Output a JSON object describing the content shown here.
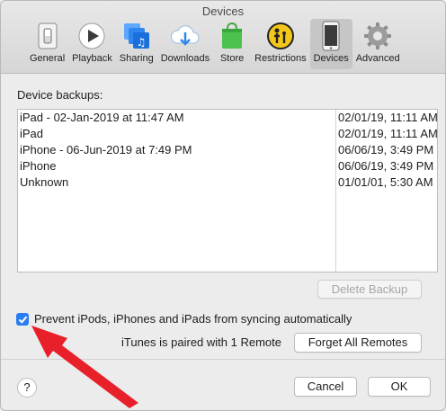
{
  "window": {
    "title": "Devices"
  },
  "toolbar": {
    "items": [
      {
        "label": "General",
        "icon": "general-switch-icon"
      },
      {
        "label": "Playback",
        "icon": "play-icon"
      },
      {
        "label": "Sharing",
        "icon": "sharing-music-icon"
      },
      {
        "label": "Downloads",
        "icon": "cloud-download-icon"
      },
      {
        "label": "Store",
        "icon": "store-bag-icon"
      },
      {
        "label": "Restrictions",
        "icon": "restrictions-parental-icon"
      },
      {
        "label": "Devices",
        "icon": "iphone-device-icon",
        "active": true
      },
      {
        "label": "Advanced",
        "icon": "gear-icon"
      }
    ]
  },
  "backups": {
    "label": "Device backups:",
    "rows": [
      {
        "name": "iPad - 02-Jan-2019 at 11:47 AM",
        "date": "02/01/19, 11:11 AM"
      },
      {
        "name": "iPad",
        "date": "02/01/19, 11:11 AM"
      },
      {
        "name": "iPhone - 06-Jun-2019 at 7:49 PM",
        "date": "06/06/19, 3:49 PM"
      },
      {
        "name": "iPhone",
        "date": "06/06/19, 3:49 PM"
      },
      {
        "name": "Unknown",
        "date": "01/01/01, 5:30 AM"
      }
    ],
    "delete_label": "Delete Backup"
  },
  "options": {
    "prevent_sync_label": "Prevent iPods, iPhones and iPads from syncing automatically",
    "prevent_sync_checked": true,
    "paired_text": "iTunes is paired with 1 Remote",
    "forget_label": "Forget All Remotes"
  },
  "footer": {
    "help_label": "?",
    "cancel_label": "Cancel",
    "ok_label": "OK"
  },
  "colors": {
    "accent": "#2b7cf3",
    "arrow": "#e8202a"
  }
}
